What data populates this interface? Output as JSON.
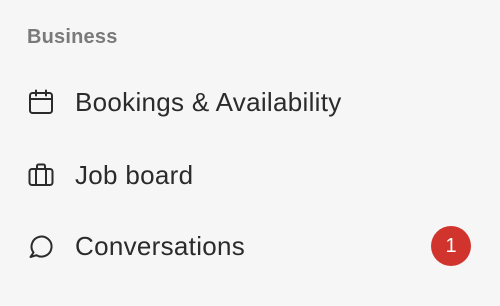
{
  "section": {
    "heading": "Business",
    "items": [
      {
        "label": "Bookings & Availability",
        "icon": "calendar-icon"
      },
      {
        "label": "Job board",
        "icon": "briefcase-icon"
      },
      {
        "label": "Conversations",
        "icon": "chat-bubble-icon",
        "badge": "1"
      }
    ]
  },
  "colors": {
    "background": "#f6f6f6",
    "text": "#2b2b2b",
    "heading": "#7a7a7a",
    "badge": "#d0342c"
  }
}
